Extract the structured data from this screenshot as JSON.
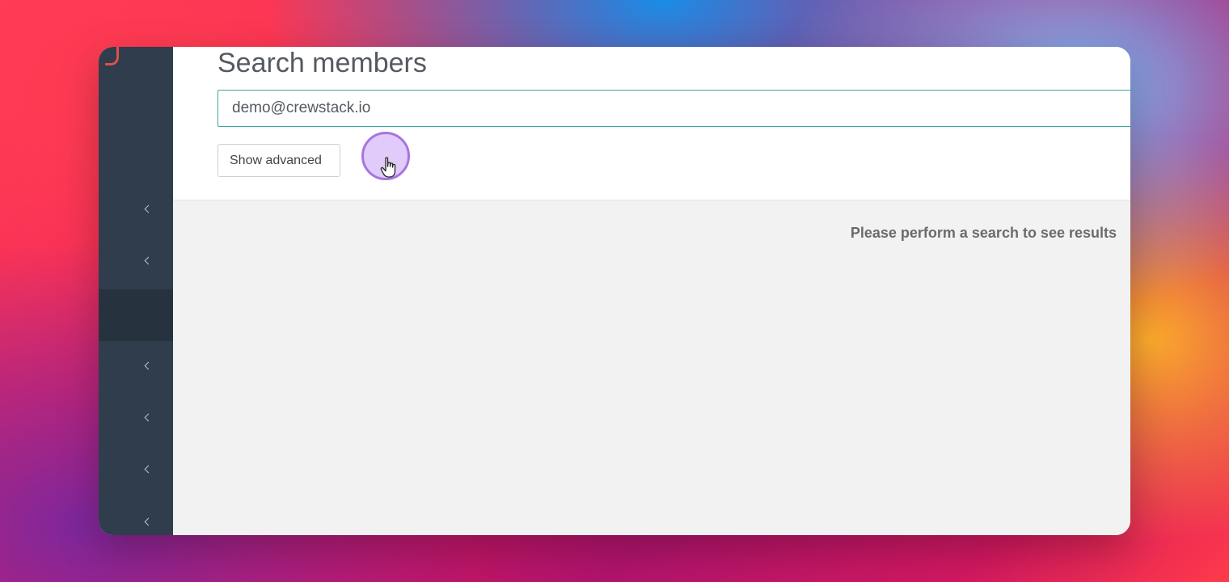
{
  "window": {
    "page_title": "Search members"
  },
  "sidebar": {
    "items": [
      {
        "icon": "chevron-left-icon",
        "active": false
      },
      {
        "icon": "chevron-left-icon",
        "active": false
      },
      {
        "icon": "",
        "active": true
      },
      {
        "icon": "chevron-left-icon",
        "active": false
      },
      {
        "icon": "chevron-left-icon",
        "active": false
      },
      {
        "icon": "chevron-left-icon",
        "active": false
      },
      {
        "icon": "chevron-left-icon",
        "active": false
      }
    ]
  },
  "search": {
    "value": "demo@crewstack.io",
    "advanced_label": "Show advanced"
  },
  "results": {
    "empty_message": "Please perform a search to see results"
  },
  "colors": {
    "sidebar_bg": "#2f3d4c",
    "input_border": "#3aa8a0",
    "click_highlight": "#a874e0"
  }
}
